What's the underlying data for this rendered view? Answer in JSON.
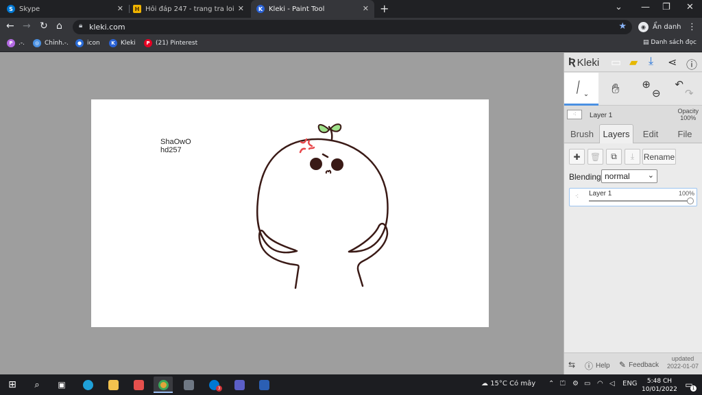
{
  "browser": {
    "tabs": [
      {
        "title": "Skype",
        "icon": "skype-icon",
        "color": "#0078d4",
        "glyph": "S"
      },
      {
        "title": "Hỏi đáp 247 - trang tra loi",
        "icon": "hoidap-icon",
        "color": "#f0b400",
        "glyph": "H"
      },
      {
        "title": "Kleki - Paint Tool",
        "icon": "kleki-icon",
        "color": "#2a62d6",
        "glyph": "K"
      }
    ],
    "close_glyph": "✕",
    "new_tab_glyph": "+",
    "window_controls": [
      "⌄",
      "—",
      "❐",
      "✕"
    ],
    "url": "kleki.com",
    "profile_label": "Ẩn danh",
    "bookmarks": [
      {
        "label": ".-.",
        "color": "#b36ae2",
        "glyph": "P"
      },
      {
        "label": "Chỉnh.-.",
        "color": "#4a90e2",
        "glyph": "◎"
      },
      {
        "label": "icon",
        "color": "#2b6cd6",
        "glyph": "●"
      },
      {
        "label": "Kleki",
        "color": "#2a62d6",
        "glyph": "K"
      },
      {
        "label": "(21) Pinterest",
        "color": "#e60023",
        "glyph": "P"
      }
    ],
    "reading_list": "Danh sách đọc"
  },
  "canvas": {
    "signature_line1": "ShaOwO",
    "signature_line2": "hd257"
  },
  "kleki": {
    "logo": "Kleki",
    "layer_name": "Layer 1",
    "opacity_label": "Opacity",
    "opacity_value": "100%",
    "tabs": [
      "Brush",
      "Layers",
      "Edit",
      "File"
    ],
    "rename_label": "Rename",
    "blending_label": "Blending",
    "blending_value": "normal",
    "layer_row_name": "Layer 1",
    "layer_row_opacity": "100%",
    "layer_opacity_fraction": 1.0,
    "help_label": "Help",
    "feedback_label": "Feedback",
    "updated_label": "updated",
    "updated_date": "2022-01-07"
  },
  "taskbar": {
    "weather": "15°C  Có mây",
    "language": "ENG",
    "time": "5:48 CH",
    "date": "10/01/2022",
    "notification_count": "1",
    "teams_badge": "3"
  }
}
